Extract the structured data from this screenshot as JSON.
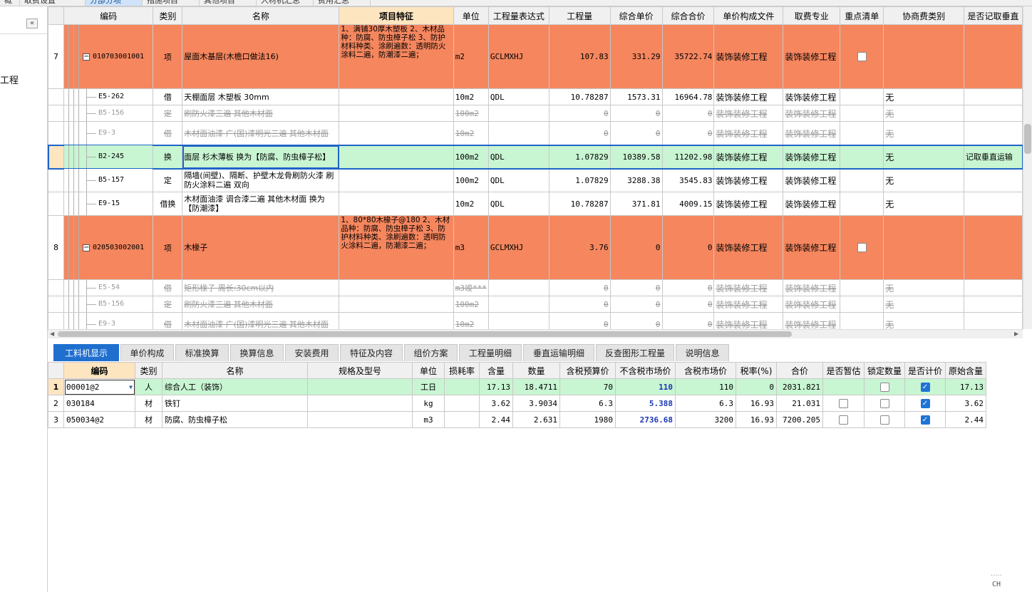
{
  "top_tabs": [
    "概况",
    "取费设置",
    "分部分项",
    "措施项目",
    "其他项目",
    "人材机汇总",
    "费用汇总"
  ],
  "sidebar": {
    "collapse_glyph": "«",
    "label": "工程"
  },
  "upper_grid": {
    "headers": [
      "",
      "编码",
      "类别",
      "名称",
      "项目特征",
      "单位",
      "工程量表达式",
      "工程量",
      "综合单价",
      "综合合价",
      "单价构成文件",
      "取费专业",
      "重点清单",
      "协商费类别",
      "是否记取垂直"
    ],
    "rows": [
      {
        "type": "parent",
        "num": "7",
        "code": "010703001001",
        "cat": "项",
        "name": "屋面木基层(木檐口做法16)",
        "feature": "1、满铺30厚木塑板\n2、木材品种：防腐、防虫樟子松\n3、防护材料种类、涂刷遍数：透明防火涂料二遍，防潮漆二遍；",
        "unit": "m2",
        "expr": "GCLMXHJ",
        "qty": "107.83",
        "price": "331.29",
        "total": "35722.74",
        "file": "装饰装修工程",
        "spec": "装饰装修工程",
        "key": "checkbox",
        "coop": "",
        "vert": ""
      },
      {
        "type": "sub",
        "num": "",
        "code": "E5-262",
        "cat": "借",
        "name": "天棚面层 木塑板 30mm",
        "feature": "",
        "unit": "10m2",
        "expr": "QDL",
        "qty": "10.78287",
        "price": "1573.31",
        "total": "16964.78",
        "file": "装饰装修工程",
        "spec": "装饰装修工程",
        "key": "",
        "coop": "无",
        "vert": ""
      },
      {
        "type": "strike",
        "num": "",
        "code": "B5-156",
        "cat": "定",
        "name": "刷防火漆三遍 其他木材面",
        "feature": "",
        "unit": "100m2",
        "expr": "",
        "qty": "0",
        "price": "0",
        "total": "0",
        "file": "装饰装修工程",
        "spec": "装饰装修工程",
        "key": "",
        "coop": "无",
        "vert": ""
      },
      {
        "type": "strike",
        "num": "",
        "code": "E9-3",
        "cat": "借",
        "name": "木材面油漆 广(国)漆明光三遍 其他木材面",
        "feature": "",
        "unit": "10m2",
        "expr": "",
        "qty": "0",
        "price": "0",
        "total": "0",
        "file": "装饰装修工程",
        "spec": "装饰装修工程",
        "key": "",
        "coop": "无",
        "vert": ""
      },
      {
        "type": "selected",
        "num": "",
        "code": "B2-245",
        "cat": "换",
        "name": "面层 杉木薄板  换为【防腐、防虫樟子松】",
        "feature": "",
        "unit": "100m2",
        "expr": "QDL",
        "qty": "1.07829",
        "price": "10389.58",
        "total": "11202.98",
        "file": "装饰装修工程",
        "spec": "装饰装修工程",
        "key": "",
        "coop": "无",
        "vert": "记取垂直运输"
      },
      {
        "type": "sub",
        "num": "",
        "code": "B5-157",
        "cat": "定",
        "name": "隔墙(间壁)、隔断、护壁木龙骨刷防火漆 刷防火涂料二遍 双向",
        "feature": "",
        "unit": "100m2",
        "expr": "QDL",
        "qty": "1.07829",
        "price": "3288.38",
        "total": "3545.83",
        "file": "装饰装修工程",
        "spec": "装饰装修工程",
        "key": "",
        "coop": "无",
        "vert": ""
      },
      {
        "type": "sub",
        "num": "",
        "code": "E9-15",
        "cat": "借换",
        "name": "木材面油漆 调合漆二遍 其他木材面  换为【防潮漆】",
        "feature": "",
        "unit": "10m2",
        "expr": "QDL",
        "qty": "10.78287",
        "price": "371.81",
        "total": "4009.15",
        "file": "装饰装修工程",
        "spec": "装饰装修工程",
        "key": "",
        "coop": "无",
        "vert": ""
      },
      {
        "type": "parent",
        "num": "8",
        "code": "020503002001",
        "cat": "项",
        "name": "木椽子",
        "feature": "1、80*80木椽子@180\n2、木材品种：防腐、防虫樟子松\n3、防护材料种类、涂刷遍数：透明防火涂料二遍，防潮漆二遍；",
        "unit": "m3",
        "expr": "GCLMXHJ",
        "qty": "3.76",
        "price": "0",
        "total": "0",
        "file": "装饰装修工程",
        "spec": "装饰装修工程",
        "key": "checkbox",
        "coop": "",
        "vert": ""
      },
      {
        "type": "strike",
        "num": "",
        "code": "E5-54",
        "cat": "借",
        "name": "矩形椽子 周长:30cm以内",
        "feature": "",
        "unit": "m3竣***",
        "expr": "",
        "qty": "0",
        "price": "0",
        "total": "0",
        "file": "装饰装修工程",
        "spec": "装饰装修工程",
        "key": "",
        "coop": "无",
        "vert": ""
      },
      {
        "type": "strike",
        "num": "",
        "code": "B5-156",
        "cat": "定",
        "name": "刷防火漆三遍 其他木材面",
        "feature": "",
        "unit": "100m2",
        "expr": "",
        "qty": "0",
        "price": "0",
        "total": "0",
        "file": "装饰装修工程",
        "spec": "装饰装修工程",
        "key": "",
        "coop": "无",
        "vert": ""
      },
      {
        "type": "strike",
        "num": "",
        "code": "E9-3",
        "cat": "借",
        "name": "木材面油漆 广(国)漆明光三遍 其他木材面",
        "feature": "",
        "unit": "10m2",
        "expr": "",
        "qty": "0",
        "price": "0",
        "total": "0",
        "file": "装饰装修工程",
        "spec": "装饰装修工程",
        "key": "",
        "coop": "无",
        "vert": ""
      }
    ]
  },
  "bottom_tabs": [
    "工料机显示",
    "单价构成",
    "标准换算",
    "换算信息",
    "安装费用",
    "特征及内容",
    "组价方案",
    "工程量明细",
    "垂直运输明细",
    "反查图形工程量",
    "说明信息"
  ],
  "lower_grid": {
    "headers": [
      "",
      "编码",
      "类别",
      "名称",
      "规格及型号",
      "单位",
      "损耗率",
      "含量",
      "数量",
      "含税预算价",
      "不含税市场价",
      "含税市场价",
      "税率(%)",
      "合价",
      "是否暂估",
      "锁定数量",
      "是否计价",
      "原始含量"
    ],
    "rows": [
      {
        "num": "1",
        "code": "00001@2",
        "cat": "人",
        "name": "综合人工（装饰）",
        "spec": "",
        "unit": "工日",
        "loss": "",
        "content": "17.13",
        "qty": "18.4711",
        "budget": "70",
        "market_notax": "110",
        "market_tax": "110",
        "rate": "0",
        "total": "2031.821",
        "est": "",
        "lock": false,
        "priced": true,
        "orig": "17.13"
      },
      {
        "num": "2",
        "code": "030184",
        "cat": "材",
        "name": "铁钉",
        "spec": "",
        "unit": "kg",
        "loss": "",
        "content": "3.62",
        "qty": "3.9034",
        "budget": "6.3",
        "market_notax": "5.388",
        "market_tax": "6.3",
        "rate": "16.93",
        "total": "21.031",
        "est": false,
        "lock": false,
        "priced": true,
        "orig": "3.62"
      },
      {
        "num": "3",
        "code": "050034@2",
        "cat": "材",
        "name": "防腐、防虫樟子松",
        "spec": "",
        "unit": "m3",
        "loss": "",
        "content": "2.44",
        "qty": "2.631",
        "budget": "1980",
        "market_notax": "2736.68",
        "market_tax": "3200",
        "rate": "16.93",
        "total": "7200.205",
        "est": false,
        "lock": false,
        "priced": true,
        "orig": "2.44"
      }
    ]
  },
  "ime": {
    "dots": ".....",
    "label": "CH"
  },
  "colors": {
    "parent_row": "#f5865e",
    "selected_row": "#c8f5d2",
    "active_tab": "#1f6fcf",
    "header_selected": "#fde5c0"
  }
}
